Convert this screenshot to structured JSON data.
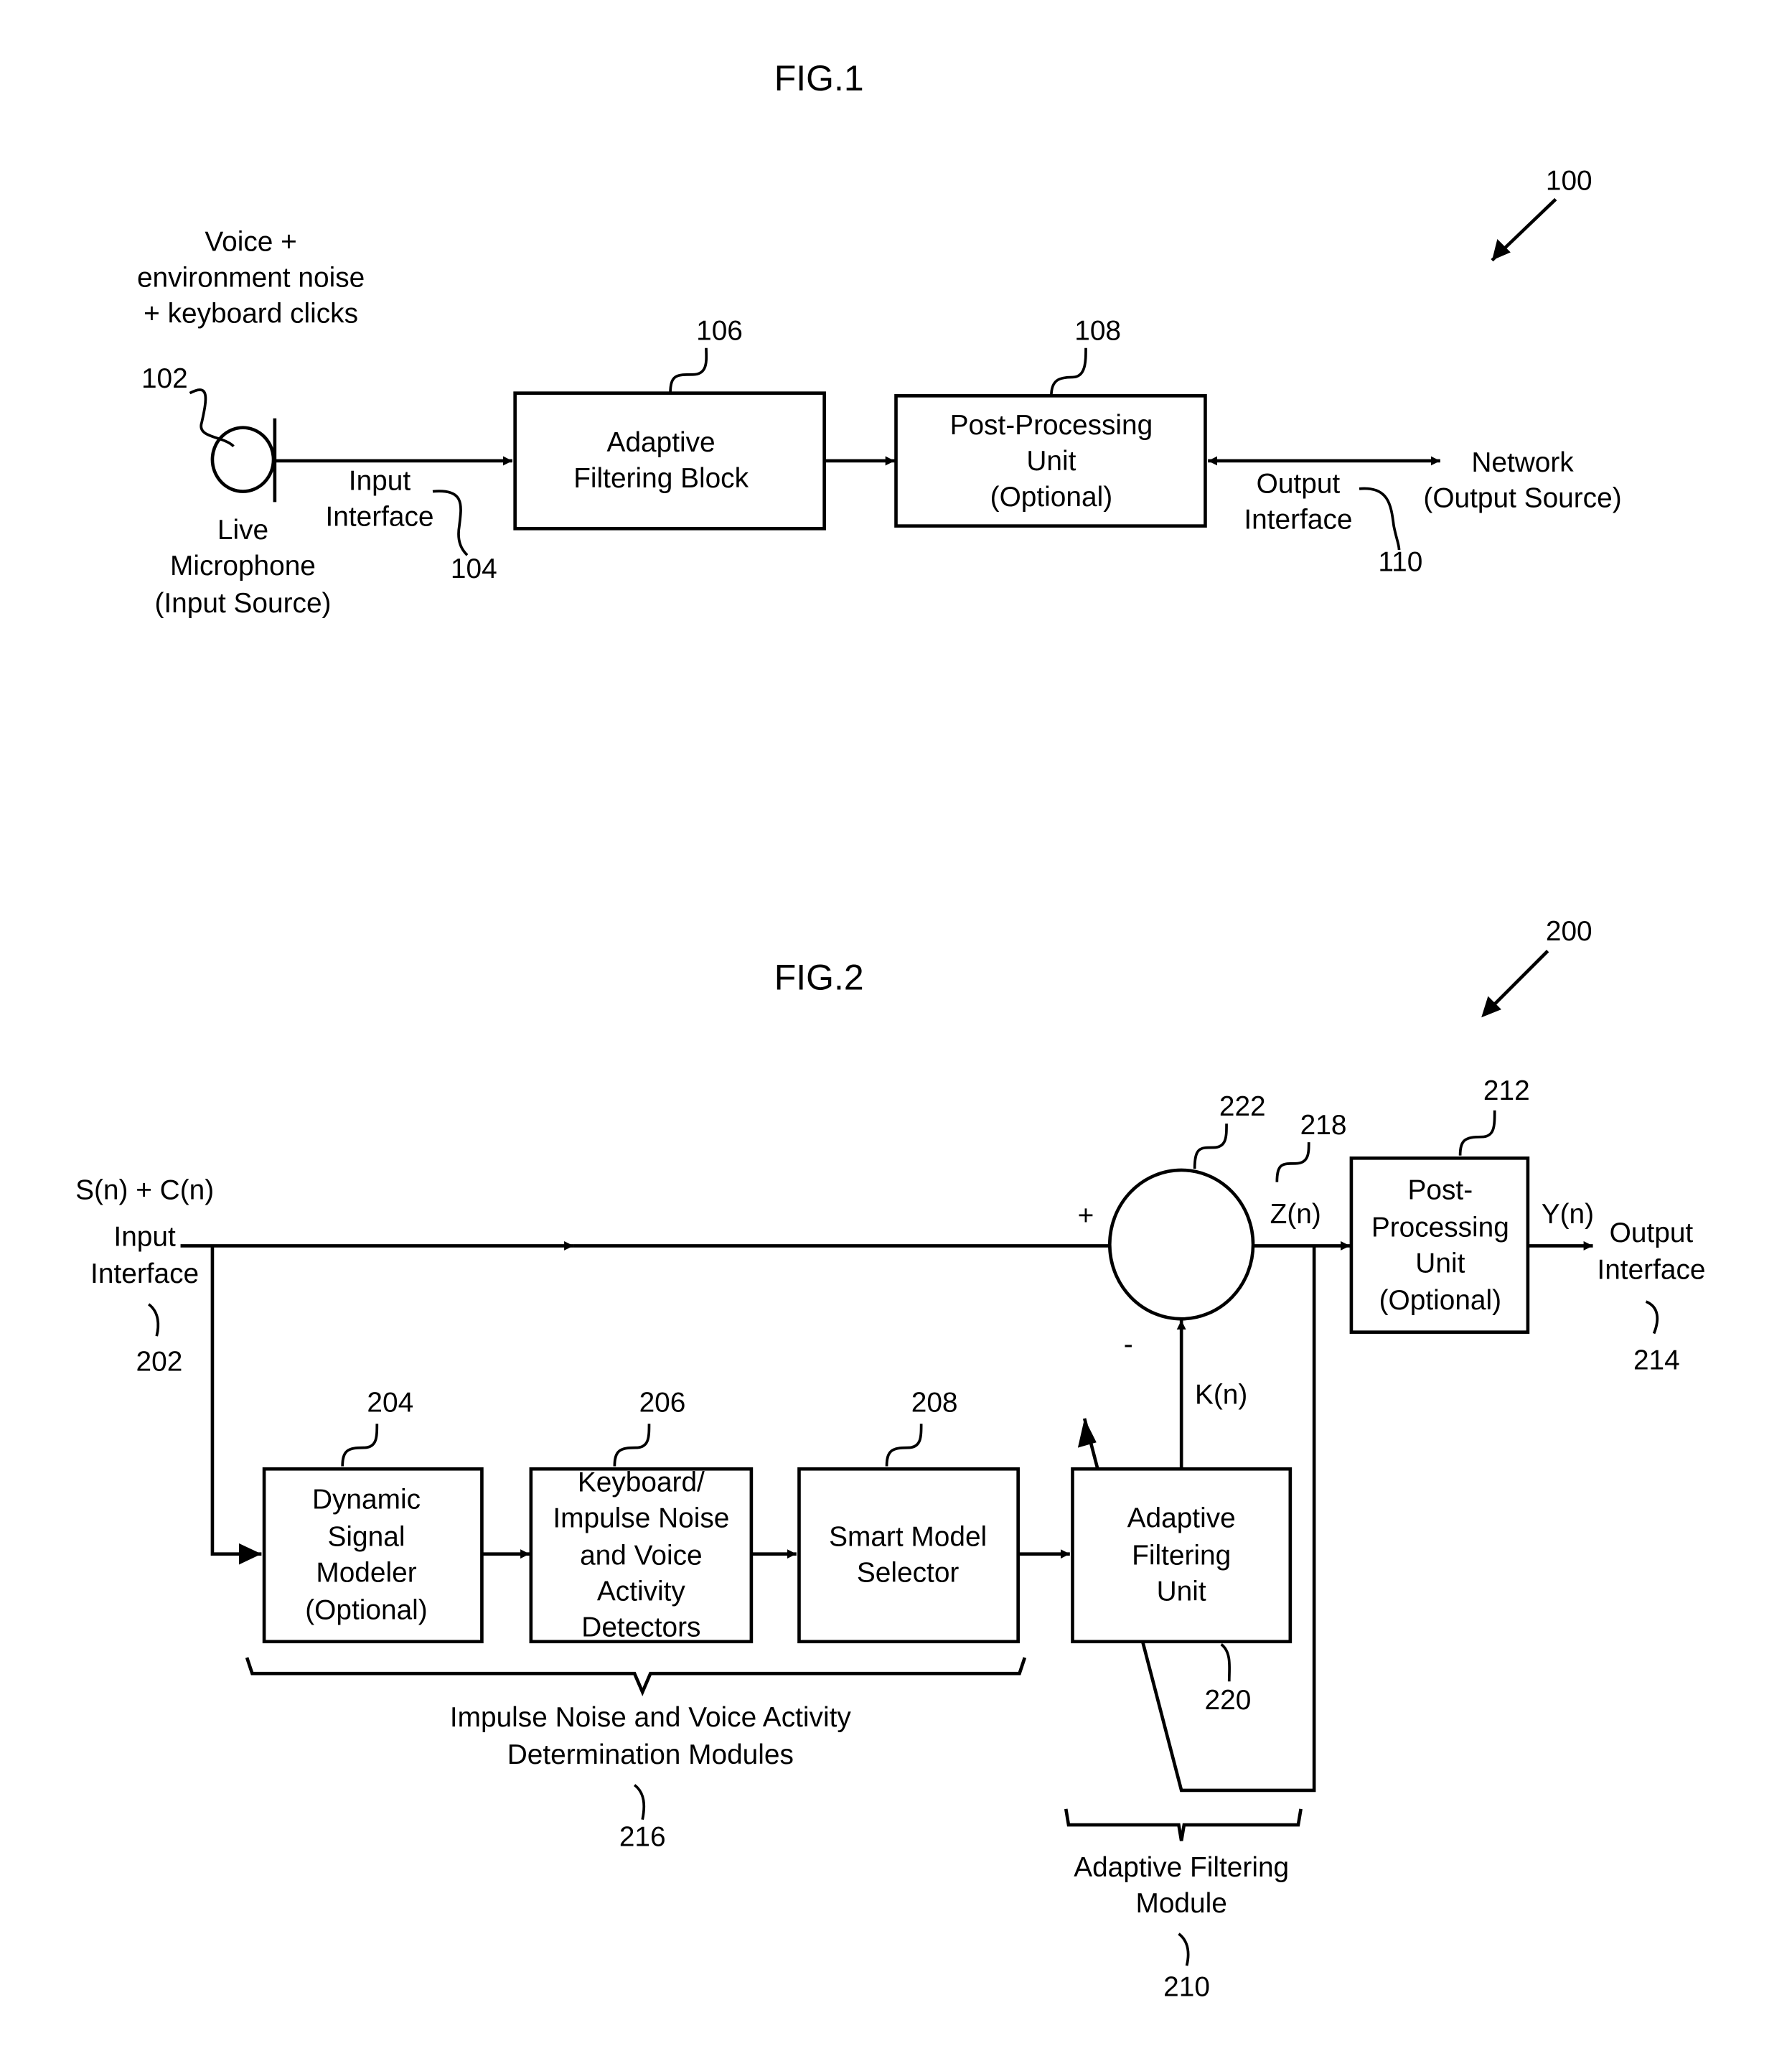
{
  "fig1": {
    "title": "FIG.1",
    "ref_overall": "100",
    "source_caption": [
      "Voice +",
      "environment noise",
      "+ keyboard clicks"
    ],
    "microphone": {
      "ref": "102",
      "label": [
        "Live",
        "Microphone",
        "(Input Source)"
      ]
    },
    "input_interface": {
      "ref": "104",
      "label": [
        "Input",
        "Interface"
      ]
    },
    "adaptive_filtering_block": {
      "ref": "106",
      "label": [
        "Adaptive",
        "Filtering Block"
      ]
    },
    "post_processing_unit": {
      "ref": "108",
      "label": [
        "Post-Processing",
        "Unit",
        "(Optional)"
      ]
    },
    "output_interface": {
      "ref": "110",
      "label": [
        "Output",
        "Interface"
      ]
    },
    "network": {
      "label": [
        "Network",
        "(Output Source)"
      ]
    }
  },
  "fig2": {
    "title": "FIG.2",
    "ref_overall": "200",
    "input_signal": "S(n) + C(n)",
    "input_interface": {
      "ref": "202",
      "label": [
        "Input",
        "Interface"
      ]
    },
    "dynamic_signal_modeler": {
      "ref": "204",
      "label": [
        "Dynamic",
        "Signal",
        "Modeler",
        "(Optional)"
      ]
    },
    "detectors": {
      "ref": "206",
      "label": [
        "Keyboard/",
        "Impulse Noise",
        "and Voice",
        "Activity",
        "Detectors"
      ]
    },
    "smart_model_selector": {
      "ref": "208",
      "label": [
        "Smart Model",
        "Selector"
      ]
    },
    "adaptive_filtering_module": {
      "ref": "210",
      "label": [
        "Adaptive Filtering",
        "Module"
      ]
    },
    "post_processing_unit": {
      "ref": "212",
      "label": [
        "Post-",
        "Processing",
        "Unit",
        "(Optional)"
      ]
    },
    "output_interface": {
      "ref": "214",
      "label": [
        "Output",
        "Interface"
      ]
    },
    "determination_modules": {
      "ref": "216",
      "label": [
        "Impulse Noise and Voice Activity",
        "Determination Modules"
      ]
    },
    "z_signal": {
      "ref": "218",
      "label": "Z(n)"
    },
    "adaptive_filtering_unit": {
      "ref": "220",
      "label": [
        "Adaptive",
        "Filtering",
        "Unit"
      ]
    },
    "summer": {
      "ref": "222",
      "plus": "+",
      "minus": "-"
    },
    "k_signal": "K(n)",
    "y_signal": "Y(n)"
  }
}
